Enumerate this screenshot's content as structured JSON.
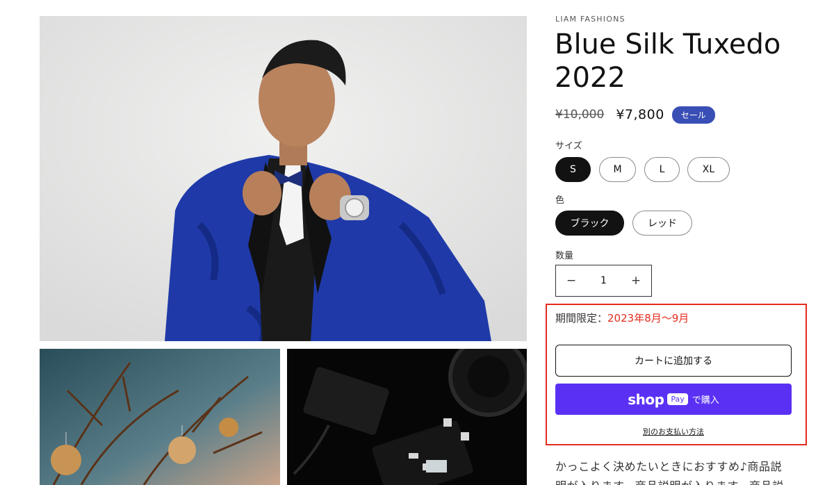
{
  "product": {
    "vendor": "LIAM FASHIONS",
    "title": "Blue Silk Tuxedo 2022",
    "price_compare": "¥10,000",
    "price_sale": "¥7,800",
    "sale_badge": "セール"
  },
  "options": {
    "size": {
      "label": "サイズ",
      "values": [
        "S",
        "M",
        "L",
        "XL"
      ],
      "selected": "S"
    },
    "color": {
      "label": "色",
      "values": [
        "ブラック",
        "レッド"
      ],
      "selected": "ブラック"
    }
  },
  "quantity": {
    "label": "数量",
    "value": "1",
    "minus": "−",
    "plus": "+"
  },
  "promo": {
    "prefix": "期間限定：",
    "period": "2023年8月〜9月"
  },
  "actions": {
    "add_to_cart": "カートに追加する",
    "shop_pay_brand": "shop",
    "shop_pay_chip": "Pay",
    "shop_pay_label": "で購入",
    "more_payment": "別のお支払い方法"
  },
  "description": "かっこよく決めたいときにおすすめ♪商品説明が入ります。商品説明が入ります。商品説",
  "colors": {
    "sale_badge": "#3a4fb5",
    "shop_pay": "#5a31f4",
    "highlight": "#e32c1d"
  }
}
